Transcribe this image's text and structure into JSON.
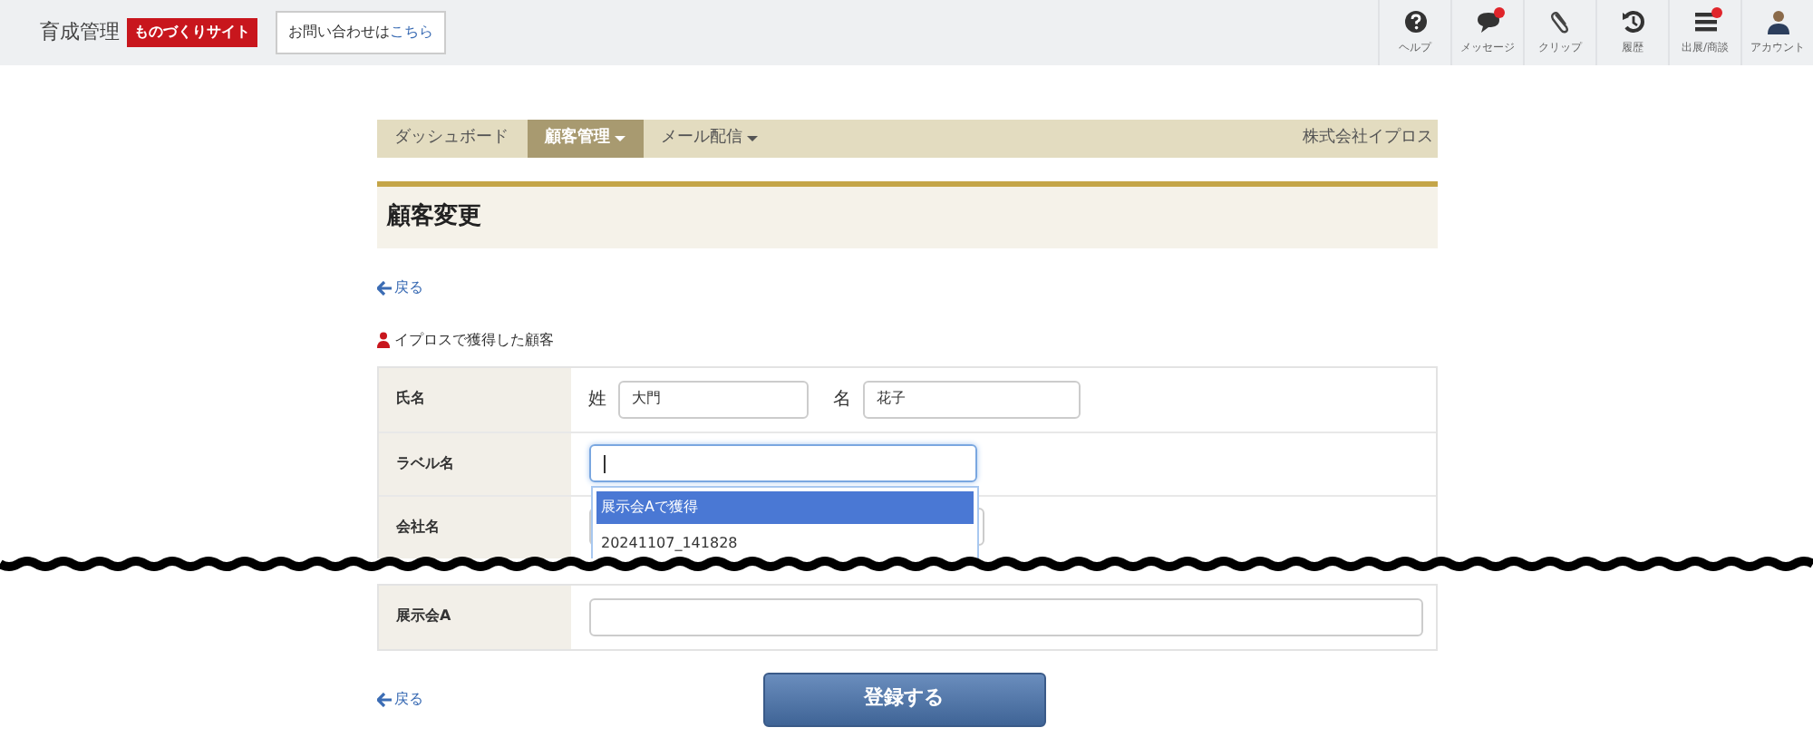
{
  "header": {
    "brand": "育成管理",
    "site_tag": "ものづくりサイト",
    "contact_text": "お問い合わせは",
    "contact_link": "こちら"
  },
  "tools": [
    {
      "kind": "help",
      "label": "ヘルプ",
      "badge": false
    },
    {
      "kind": "message",
      "label": "メッセージ",
      "badge": true
    },
    {
      "kind": "clip",
      "label": "クリップ",
      "badge": false
    },
    {
      "kind": "history",
      "label": "履歴",
      "badge": false
    },
    {
      "kind": "list",
      "label": "出展/商談",
      "badge": true
    },
    {
      "kind": "account",
      "label": "アカウント",
      "badge": false
    }
  ],
  "nav": {
    "items": [
      {
        "label": "ダッシュボード",
        "selected": false,
        "dropdown": false
      },
      {
        "label": "顧客管理",
        "selected": true,
        "dropdown": true
      },
      {
        "label": "メール配信",
        "selected": false,
        "dropdown": true
      }
    ],
    "company": "株式会社イプロス"
  },
  "page_title": "顧客変更",
  "back_link": "戻る",
  "source_label": "イプロスで獲得した顧客",
  "form": [
    {
      "kind": "name",
      "label": "氏名",
      "last_label": "姓",
      "last_value": "大門",
      "first_label": "名",
      "first_value": "花子"
    },
    {
      "kind": "combo",
      "label": "ラベル名",
      "focused": true,
      "options": [
        {
          "text": "展示会Aで獲得",
          "selected": true
        },
        {
          "text": "20241107_141828",
          "selected": false
        }
      ]
    },
    {
      "kind": "text",
      "label": "会社名"
    }
  ],
  "form2": [
    {
      "kind": "text",
      "label": "展示会A"
    }
  ],
  "submit": "登録する",
  "footer_back_link": "戻る"
}
